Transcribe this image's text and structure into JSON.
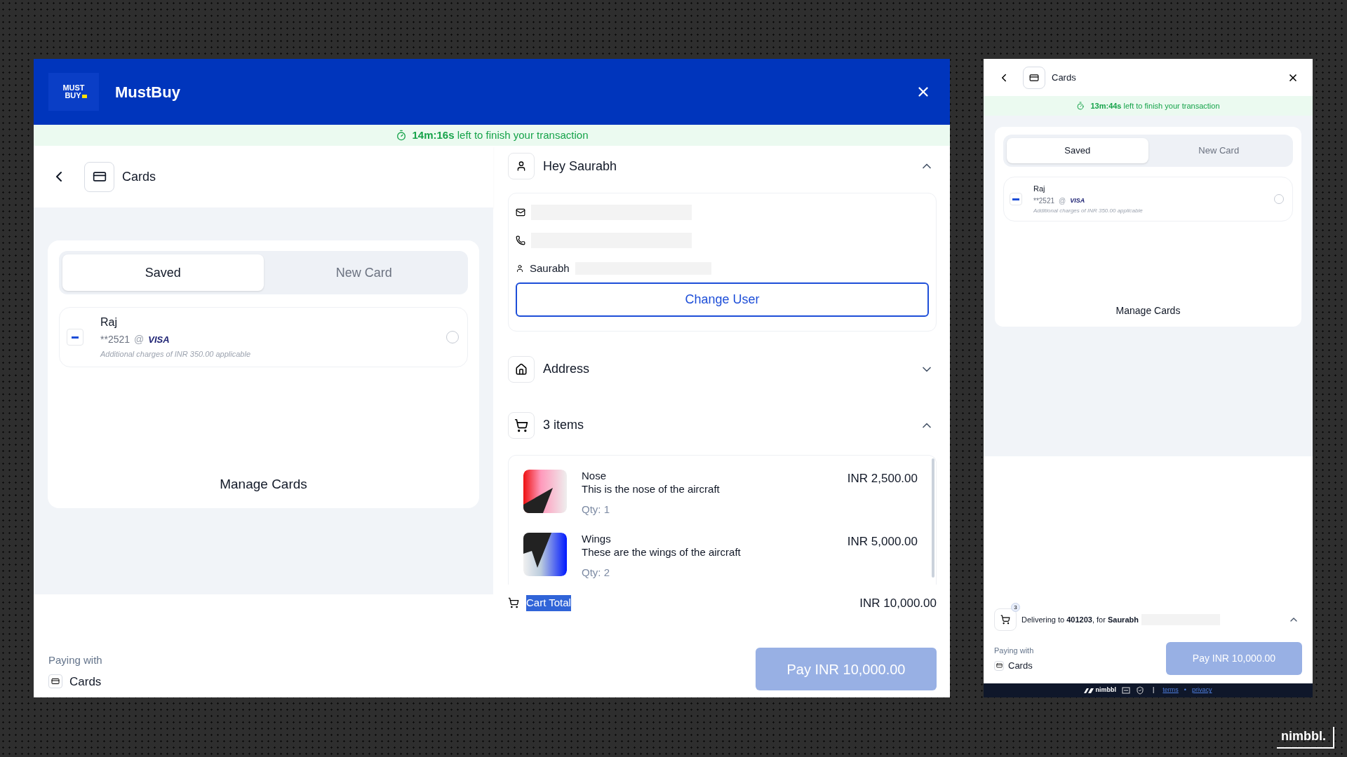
{
  "main_window": {
    "logo": [
      "MUST",
      "BUY"
    ],
    "brand": "MustBuy",
    "timer": {
      "time": "14m:16s",
      "text": "left to finish your transaction"
    },
    "method_title": "Cards",
    "card_tabs": [
      {
        "label": "Saved",
        "selected": true
      },
      {
        "label": "New Card",
        "selected": false
      }
    ],
    "saved_cards": [
      {
        "name": "Raj",
        "number": "**2521",
        "at": "@",
        "network": "VISA",
        "note": "Additional charges of INR 350.00 applicable",
        "selected": false
      }
    ],
    "manage_link": "Manage Cards",
    "user_section": {
      "title": "Hey Saurabh",
      "expanded": true,
      "name": "Saurabh",
      "button": "Change User"
    },
    "address_section": {
      "title": "Address",
      "expanded": false
    },
    "items_section": {
      "title": "3 items",
      "expanded": true,
      "items": [
        {
          "name": "Nose",
          "description": "This is the nose of the aircraft",
          "qty": "Qty: 1",
          "price": "INR 2,500.00"
        },
        {
          "name": "Wings",
          "description": "These are the wings of the aircraft",
          "qty": "Qty: 2",
          "price": "INR 5,000.00"
        }
      ]
    },
    "cart_total": {
      "label": "Cart Total",
      "value": "INR 10,000.00"
    },
    "paying_with": {
      "label": "Paying with",
      "method": "Cards"
    },
    "pay_button": {
      "label": "Pay INR 10,000.00",
      "disabled": true
    }
  },
  "mobile_window": {
    "title": "Cards",
    "timer": {
      "time": "13m:44s",
      "text": "left to finish your transaction"
    },
    "card_tabs": [
      {
        "label": "Saved",
        "selected": true
      },
      {
        "label": "New Card",
        "selected": false
      }
    ],
    "saved_cards": [
      {
        "name": "Raj",
        "number": "**2521",
        "at": "@",
        "network": "VISA",
        "note": "Additional charges of INR 350.00 applicable",
        "selected": false
      }
    ],
    "manage_link": "Manage Cards",
    "delivery": {
      "badge": "3",
      "text": "Delivering to **401203**, for **Saurabh**",
      "expanded": true
    },
    "paying_with": {
      "label": "Paying with",
      "method": "Cards"
    },
    "pay_button": {
      "label": "Pay INR 10,000.00",
      "disabled": true
    },
    "footer": {
      "brand": "nimbbl",
      "separator": "|",
      "links": [
        "terms",
        "privacy"
      ],
      "dot": "•"
    }
  },
  "corner_logo": "nimbbl."
}
